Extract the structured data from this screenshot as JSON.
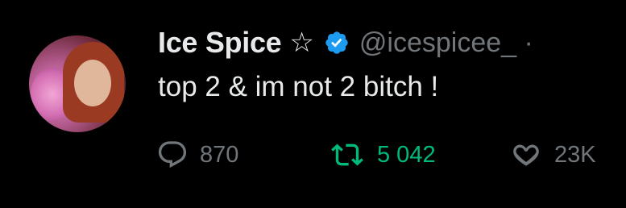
{
  "tweet": {
    "display_name": "Ice Spice",
    "name_suffix": "☆",
    "verified_icon": "verified-badge-icon",
    "handle": "@icespicee_ ·",
    "text": "top 2 & im not 2 bitch !",
    "actions": {
      "reply_count": "870",
      "retweet_count": "5 042",
      "like_count": "23K"
    },
    "colors": {
      "background": "#000000",
      "primary_text": "#e7e9ea",
      "secondary_text": "#71767b",
      "verified": "#1d9bf0",
      "retweet_active": "#00ba7c"
    }
  }
}
